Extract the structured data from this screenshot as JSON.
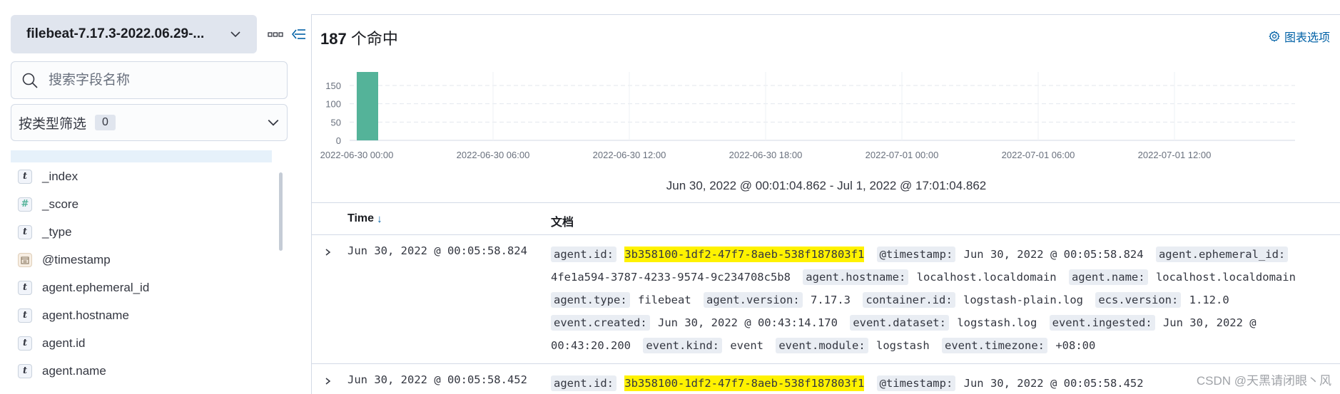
{
  "sidebar": {
    "index_pattern": "filebeat-7.17.3-2022.06.29-...",
    "search_placeholder": "搜索字段名称",
    "type_filter_label": "按类型筛选",
    "type_filter_count": "0",
    "fields": [
      {
        "type": "string",
        "icon": "t",
        "name": "_index"
      },
      {
        "type": "number",
        "icon": "#",
        "name": "_score"
      },
      {
        "type": "string",
        "icon": "t",
        "name": "_type"
      },
      {
        "type": "date",
        "icon": "calendar-icon",
        "name": "@timestamp"
      },
      {
        "type": "string",
        "icon": "t",
        "name": "agent.ephemeral_id"
      },
      {
        "type": "string",
        "icon": "t",
        "name": "agent.hostname"
      },
      {
        "type": "string",
        "icon": "t",
        "name": "agent.id"
      },
      {
        "type": "string",
        "icon": "t",
        "name": "agent.name"
      }
    ]
  },
  "main": {
    "hits_count": "187",
    "hits_label": " 个命中",
    "chart_options_label": "图表选项",
    "time_range": "Jun 30, 2022 @ 00:01:04.862 - Jul 1, 2022 @ 17:01:04.862",
    "columns": {
      "time": "Time",
      "document": "文档"
    },
    "rows": [
      {
        "time": "Jun 30, 2022 @ 00:05:58.824",
        "fields": [
          {
            "k": "agent.id:",
            "v": "3b358100-1df2-47f7-8aeb-538f187803f1",
            "highlight": true
          },
          {
            "k": "@timestamp:",
            "v": "Jun 30, 2022 @ 00:05:58.824"
          },
          {
            "k": "agent.ephemeral_id:",
            "v": "4fe1a594-3787-4233-9574-9c234708c5b8"
          },
          {
            "k": "agent.hostname:",
            "v": "localhost.localdomain"
          },
          {
            "k": "agent.name:",
            "v": "localhost.localdomain"
          },
          {
            "k": "agent.type:",
            "v": "filebeat"
          },
          {
            "k": "agent.version:",
            "v": "7.17.3"
          },
          {
            "k": "container.id:",
            "v": "logstash-plain.log"
          },
          {
            "k": "ecs.version:",
            "v": "1.12.0"
          },
          {
            "k": "event.created:",
            "v": "Jun 30, 2022 @ 00:43:14.170"
          },
          {
            "k": "event.dataset:",
            "v": "logstash.log"
          },
          {
            "k": "event.ingested:",
            "v": "Jun 30, 2022 @ 00:43:20.200"
          },
          {
            "k": "event.kind:",
            "v": "event"
          },
          {
            "k": "event.module:",
            "v": "logstash"
          },
          {
            "k": "event.timezone:",
            "v": "+08:00"
          }
        ]
      },
      {
        "time": "Jun 30, 2022 @ 00:05:58.452",
        "fields": [
          {
            "k": "agent.id:",
            "v": "3b358100-1df2-47f7-8aeb-538f187803f1",
            "highlight": true
          },
          {
            "k": "@timestamp:",
            "v": "Jun 30, 2022 @ 00:05:58.452"
          }
        ]
      }
    ]
  },
  "chart_data": {
    "type": "bar",
    "x": [
      "2022-06-30 00:00"
    ],
    "values": [
      187
    ],
    "x_tick_labels": [
      "2022-06-30 00:00",
      "2022-06-30 06:00",
      "2022-06-30 12:00",
      "2022-06-30 18:00",
      "2022-07-01 00:00",
      "2022-07-01 06:00",
      "2022-07-01 12:00"
    ],
    "y_ticks": [
      0,
      50,
      100,
      150
    ],
    "ylim": [
      0,
      187
    ],
    "bar_color": "#54b399",
    "grid": true
  },
  "watermark": "CSDN @天黑请闭眼丶风"
}
